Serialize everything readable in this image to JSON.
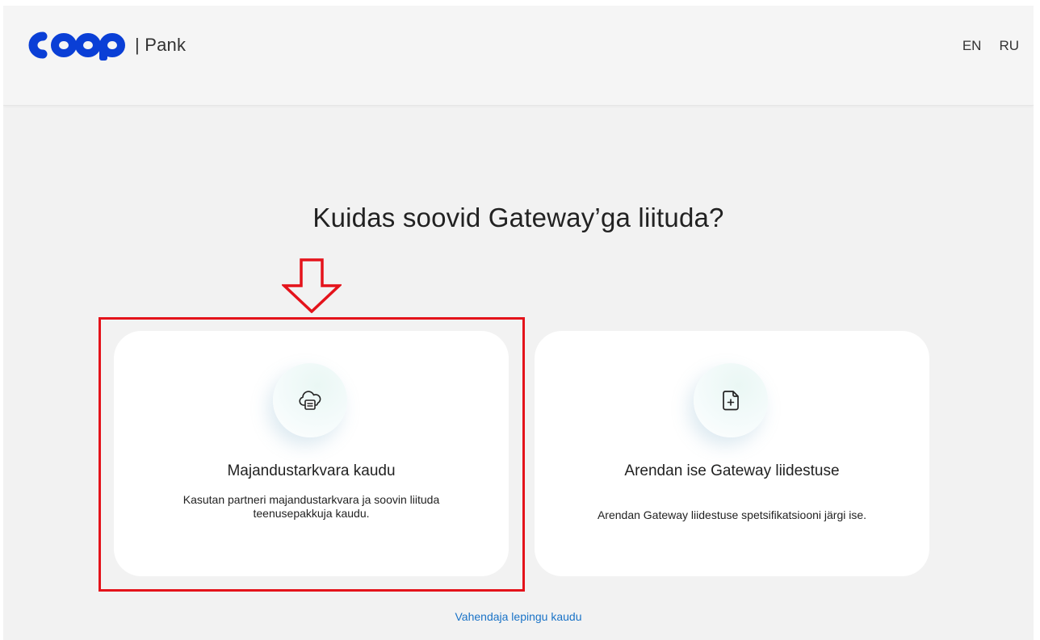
{
  "header": {
    "logo_text": "COOP",
    "logo_suffix": "| Pank",
    "languages": [
      "EN",
      "RU"
    ]
  },
  "main": {
    "title": "Kuidas soovid Gateway’ga liituda?",
    "options": [
      {
        "title": "Majandustarkvara kaudu",
        "description": "Kasutan partneri majandustarkvara ja soovin liituda teenusepakkuja kaudu.",
        "icon": "cloud-document-icon",
        "highlighted": true
      },
      {
        "title": "Arendan ise Gateway liidestuse",
        "description": "Arendan Gateway liidestuse spetsifikatsiooni järgi ise.",
        "icon": "add-document-icon",
        "highlighted": false
      }
    ],
    "footer_link": "Vahendaja lepingu kaudu"
  },
  "colors": {
    "brand": "#0a3fd6",
    "highlight": "#e4131b",
    "link": "#1a73c7"
  }
}
